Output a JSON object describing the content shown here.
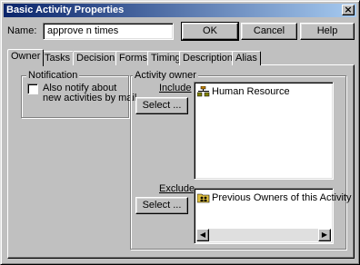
{
  "window": {
    "title": "Basic Activity Properties",
    "close_glyph": "×"
  },
  "name_field": {
    "label": "Name:",
    "value": "approve n times"
  },
  "buttons": {
    "ok": "OK",
    "cancel": "Cancel",
    "help": "Help"
  },
  "tabs": [
    {
      "label": "Owner",
      "active": true
    },
    {
      "label": "Tasks"
    },
    {
      "label": "Decision"
    },
    {
      "label": "Forms"
    },
    {
      "label": "Timing"
    },
    {
      "label": "Description"
    },
    {
      "label": "Alias"
    }
  ],
  "notification": {
    "group_label": "Notification",
    "checkbox_label_line1": "Also notify about",
    "checkbox_label_line2": "new activities by mail",
    "checked": false
  },
  "activity_owner": {
    "group_label": "Activity owner",
    "include_label": "Include",
    "include_select": "Select ...",
    "include_items": [
      {
        "label": "Human Resource",
        "icon": "group-icon"
      }
    ],
    "exclude_label": "Exclude",
    "exclude_select": "Select ...",
    "exclude_items": [
      {
        "label": "Previous Owners of this Activity",
        "icon": "folder-users-icon"
      }
    ],
    "scroll_left": "◀",
    "scroll_right": "▶"
  }
}
